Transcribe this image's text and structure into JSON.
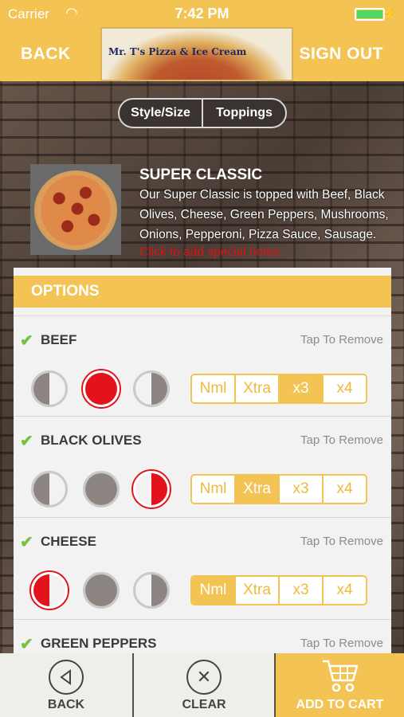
{
  "status": {
    "carrier": "Carrier",
    "time": "7:42 PM"
  },
  "nav": {
    "back": "BACK",
    "sign_out": "SIGN OUT",
    "logo_text": "Mr. T's Pizza & Ice Cream"
  },
  "tabs": [
    {
      "label": "Style/Size"
    },
    {
      "label": "Toppings"
    }
  ],
  "product": {
    "title": "SUPER CLASSIC",
    "description": "Our Super Classic is topped with Beef, Black Olives, Cheese, Green Peppers, Mushrooms, Onions, Pepperoni, Pizza Sauce, Sausage.",
    "notes_link": "Click to add special notes."
  },
  "options": {
    "header": "OPTIONS",
    "remove_label": "Tap To Remove",
    "quantity_labels": [
      "Nml",
      "Xtra",
      "x3",
      "x4"
    ],
    "items": [
      {
        "name": "BEEF",
        "placement": "whole",
        "quantity": "x3"
      },
      {
        "name": "BLACK OLIVES",
        "placement": "right",
        "quantity": "Xtra"
      },
      {
        "name": "CHEESE",
        "placement": "left",
        "quantity": "Nml"
      },
      {
        "name": "GREEN PEPPERS",
        "placement": "",
        "quantity": ""
      }
    ]
  },
  "bottom": {
    "back": "BACK",
    "clear": "CLEAR",
    "add_to_cart": "ADD TO CART"
  },
  "colors": {
    "accent": "#f3c453",
    "selected_placement": "#e3131b",
    "check": "#7ac043"
  }
}
